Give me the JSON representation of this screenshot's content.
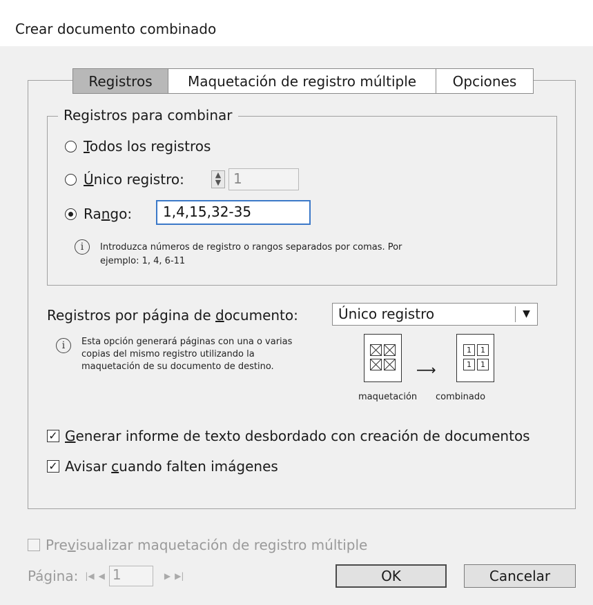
{
  "window": {
    "title": "Crear documento combinado"
  },
  "tabs": [
    {
      "label": "Registros",
      "active": true
    },
    {
      "label": "Maquetación de registro múltiple",
      "active": false
    },
    {
      "label": "Opciones",
      "active": false
    }
  ],
  "records_group": {
    "legend": "Registros para combinar",
    "all_records": {
      "pre": "",
      "key": "T",
      "post": "odos los registros",
      "checked": false
    },
    "single_record": {
      "pre": "",
      "key": "Ú",
      "post": "nico registro:",
      "value": "1",
      "checked": false
    },
    "range": {
      "pre": "Ra",
      "key": "n",
      "post": "go:",
      "value": "1,4,15,32-35",
      "checked": true
    },
    "info": "Introduzca números de registro o rangos separados por comas. Por ejemplo: 1, 4, 6-11"
  },
  "records_per_page": {
    "label_pre": "Registros por página de ",
    "label_key": "d",
    "label_post": "ocumento:",
    "selected": "Único registro",
    "info": "Esta opción generará páginas con una o varias copias del mismo registro utilizando la maquetación de su documento de destino.",
    "diagram": {
      "left_label": "maquetación",
      "right_label": "combinado",
      "cell_text": "1"
    }
  },
  "options": {
    "overset_report": {
      "pre": "",
      "key": "G",
      "post": "enerar informe de texto desbordado con creación de documentos",
      "checked": true
    },
    "missing_images": {
      "pre": "Avisar ",
      "key": "c",
      "post": "uando falten imágenes",
      "checked": true
    }
  },
  "preview": {
    "pre": "Pre",
    "key": "v",
    "post": "isualizar maquetación de registro múltiple",
    "checked": false
  },
  "page_nav": {
    "label_pre": "Pá",
    "label_key": "g",
    "label_post": "ina:",
    "value": "1"
  },
  "buttons": {
    "ok": "OK",
    "cancel": "Cancelar"
  },
  "colors": {
    "focus_border": "#3a78c8",
    "active_tab": "#b8b8b8"
  }
}
